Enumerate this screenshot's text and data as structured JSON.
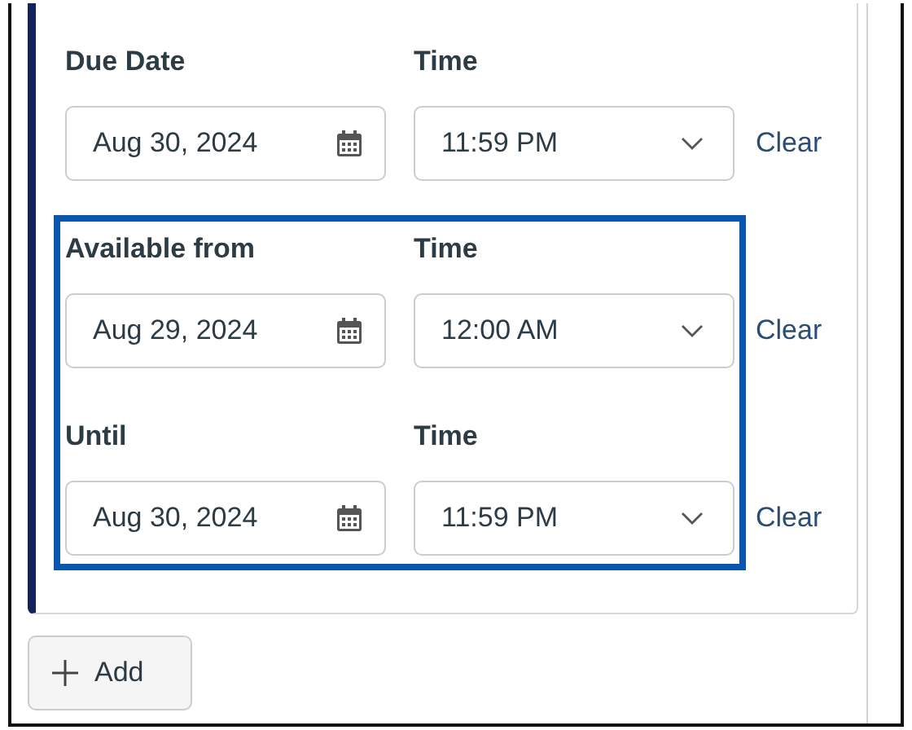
{
  "groups": [
    {
      "highlighted": false,
      "rows": [
        {
          "date_label": "Due Date",
          "date": "Aug 30, 2024",
          "time_label": "Time",
          "time": "11:59 PM",
          "clear": "Clear"
        }
      ]
    },
    {
      "highlighted": true,
      "rows": [
        {
          "date_label": "Available from",
          "date": "Aug 29, 2024",
          "time_label": "Time",
          "time": "12:00 AM",
          "clear": "Clear"
        },
        {
          "date_label": "Until",
          "date": "Aug 30, 2024",
          "time_label": "Time",
          "time": "11:59 PM",
          "clear": "Clear"
        }
      ]
    }
  ],
  "add_button": {
    "label": "Add"
  }
}
